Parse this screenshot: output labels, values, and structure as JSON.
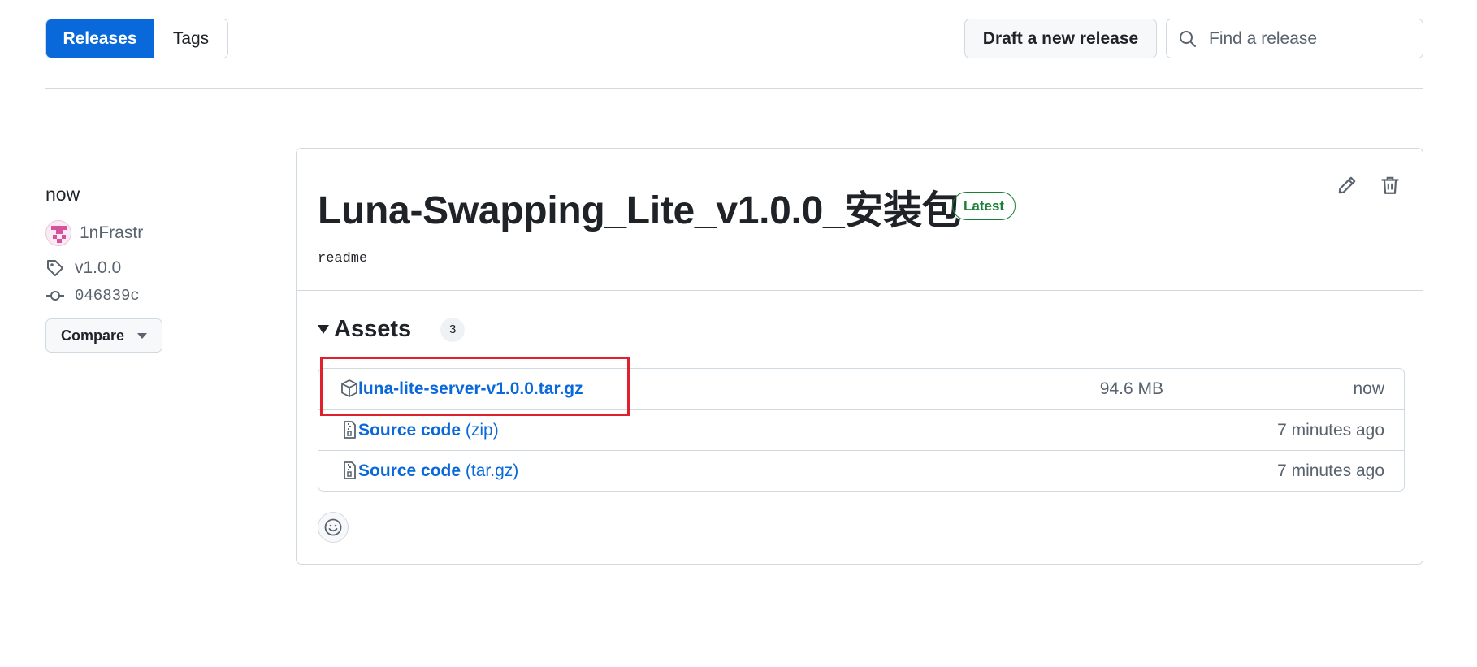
{
  "tabs": {
    "releases": "Releases",
    "tags": "Tags"
  },
  "toolbar": {
    "draft_label": "Draft a new release",
    "search_placeholder": "Find a release"
  },
  "meta": {
    "time": "now",
    "author": "1nFrastr",
    "tag": "v1.0.0",
    "commit": "046839c",
    "compare_label": "Compare"
  },
  "release": {
    "title": "Luna-Swapping_Lite_v1.0.0_安装包",
    "badge": "Latest",
    "body": "readme"
  },
  "assets": {
    "title": "Assets",
    "count": "3",
    "items": [
      {
        "name": "luna-lite-server-v1.0.0.tar.gz",
        "ext": "",
        "size": "94.6 MB",
        "time": "now",
        "icon": "package-icon"
      },
      {
        "name": "Source code",
        "ext": "(zip)",
        "size": "",
        "time": "7 minutes ago",
        "icon": "file-zip-icon"
      },
      {
        "name": "Source code",
        "ext": "(tar.gz)",
        "size": "",
        "time": "7 minutes ago",
        "icon": "file-zip-icon"
      }
    ]
  },
  "colors": {
    "accent": "#0969da",
    "latest": "#1a7f37",
    "highlight": "#e0202c"
  }
}
